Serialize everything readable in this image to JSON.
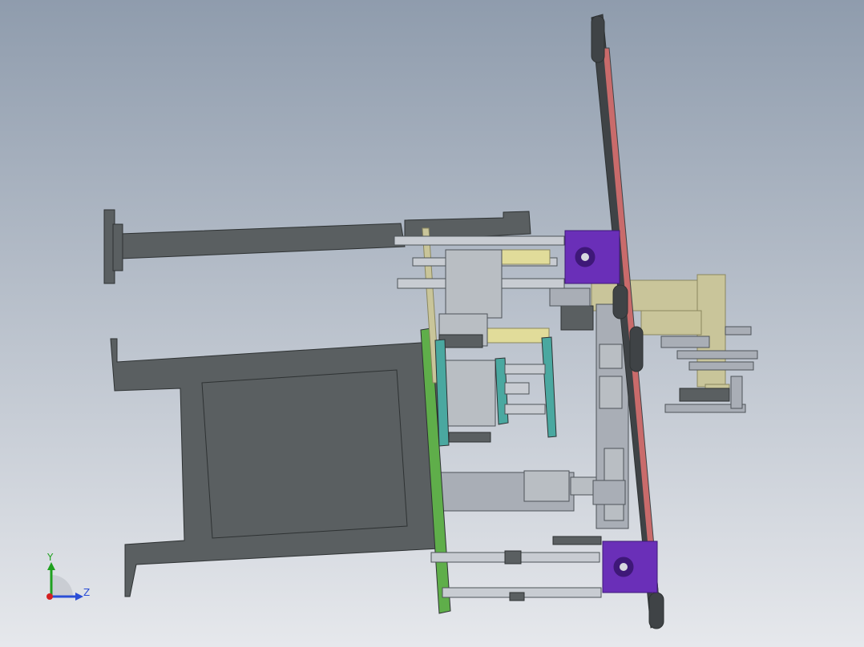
{
  "viewport": {
    "background_top": "#8f9cad",
    "background_bottom": "#e6e8ec"
  },
  "model": {
    "colors": {
      "frame_dark": "#5a5f61",
      "frame_outline": "#2e3233",
      "shaft_gray": "#c8ccd2",
      "shaft_outline": "#4d5358",
      "motor_silver": "#b9bec3",
      "purple_block": "#6a2fb8",
      "purple_dark": "#3e1878",
      "red_rail": "#c96b6b",
      "green_plate": "#5fae4a",
      "teal_plate": "#4aa8a0",
      "khaki_block": "#c9c59a",
      "khaki_dark": "#8a875f",
      "yellow_rod": "#e1dc9a",
      "light_gray": "#a9aeb6",
      "chain_dark": "#3f4346"
    }
  },
  "triad": {
    "y_label": "Y",
    "z_label": "Z",
    "y_color": "#1fa01f",
    "z_color": "#2a4dd6",
    "x_color": "#d42020"
  }
}
